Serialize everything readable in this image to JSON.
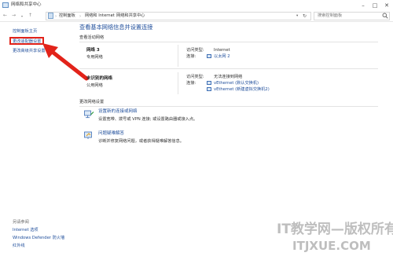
{
  "window": {
    "title": "网络和共享中心",
    "buttons": {
      "minimize": "–",
      "maximize": "□",
      "close": "✕"
    }
  },
  "addressbar": {
    "nav": {
      "back": "←",
      "forward": "→",
      "up": "↑"
    },
    "crumbs": [
      "控制面板",
      "网络和 Internet",
      "网络和共享中心"
    ],
    "search_placeholder": "搜索控制面板"
  },
  "sidebar": {
    "items": [
      {
        "label": "控制面板主页"
      },
      {
        "label": "更改适配器设置"
      },
      {
        "label": "更改高级共享设置"
      }
    ],
    "see_also_title": "另请参阅",
    "see_also": [
      {
        "label": "Internet 选项"
      },
      {
        "label": "Windows Defender 防火墙"
      },
      {
        "label": "红外线"
      }
    ]
  },
  "main": {
    "title": "查看基本网络信息并设置连接",
    "active_networks_title": "查看活动网络",
    "networks": [
      {
        "name": "网络 3",
        "type": "专用网络",
        "access_type_label": "访问类型:",
        "access_type": "Internet",
        "connection_label": "连接:",
        "connections": [
          "以太网 2"
        ]
      },
      {
        "name": "未识别的网络",
        "type": "公用网络",
        "access_type_label": "访问类型:",
        "access_type": "无法连接到网络",
        "connection_label": "连接:",
        "connections": [
          "vEthernet (默认交换机)",
          "vEthernet (新建虚拟交换机2)"
        ]
      }
    ],
    "change_settings_title": "更改网络设置",
    "tasks": [
      {
        "icon": "network-setup-icon",
        "link": "设置新的连接或网络",
        "desc": "设置宽带、拨号或 VPN 连接; 或设置路由器或接入点。"
      },
      {
        "icon": "troubleshoot-icon",
        "link": "问题疑难解答",
        "desc": "诊断并修复网络问题，或者获得疑难解答信息。"
      }
    ]
  },
  "watermark": {
    "line1": "IT教学网—版权所有",
    "line2": "ITJXUE.COM"
  },
  "colors": {
    "link": "#1f4e9b",
    "highlight": "#e2231a"
  }
}
